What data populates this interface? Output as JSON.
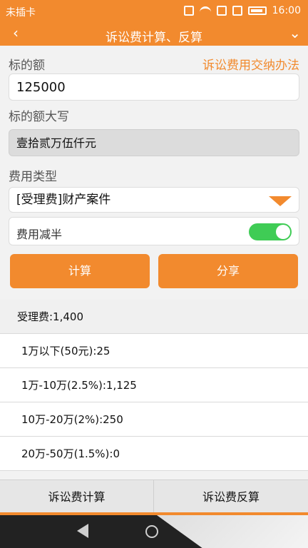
{
  "status_bar": {
    "carrier": "未插卡",
    "time": "16:00",
    "icons": [
      "vibrate-icon",
      "wifi-icon",
      "sim-slot-1-icon",
      "sim-slot-2-icon",
      "battery-icon"
    ]
  },
  "title_bar": {
    "title": "诉讼费计算、反算",
    "back_icon": "chevron-left-icon",
    "menu_icon": "chevron-down-icon"
  },
  "form": {
    "amount_label": "标的额",
    "payment_link": "诉讼费用交纳办法",
    "amount_value": "125000",
    "amount_caps_label": "标的额大写",
    "amount_caps_value": "壹拾贰万伍仟元",
    "fee_type_label": "费用类型",
    "fee_type_selected": "[受理费]财产案件",
    "half_fee_label": "费用减半",
    "half_fee_on": true
  },
  "buttons": {
    "calculate": "计算",
    "share": "分享"
  },
  "results": [
    "受理费:1,400",
    "1万以下(50元):25",
    "1万-10万(2.5%):1,125",
    "10万-20万(2%):250",
    "20万-50万(1.5%):0"
  ],
  "tabs": {
    "left": "诉讼费计算",
    "right": "诉讼费反算"
  },
  "colors": {
    "accent": "#f28a2e",
    "toggle_on": "#3fcc55"
  }
}
